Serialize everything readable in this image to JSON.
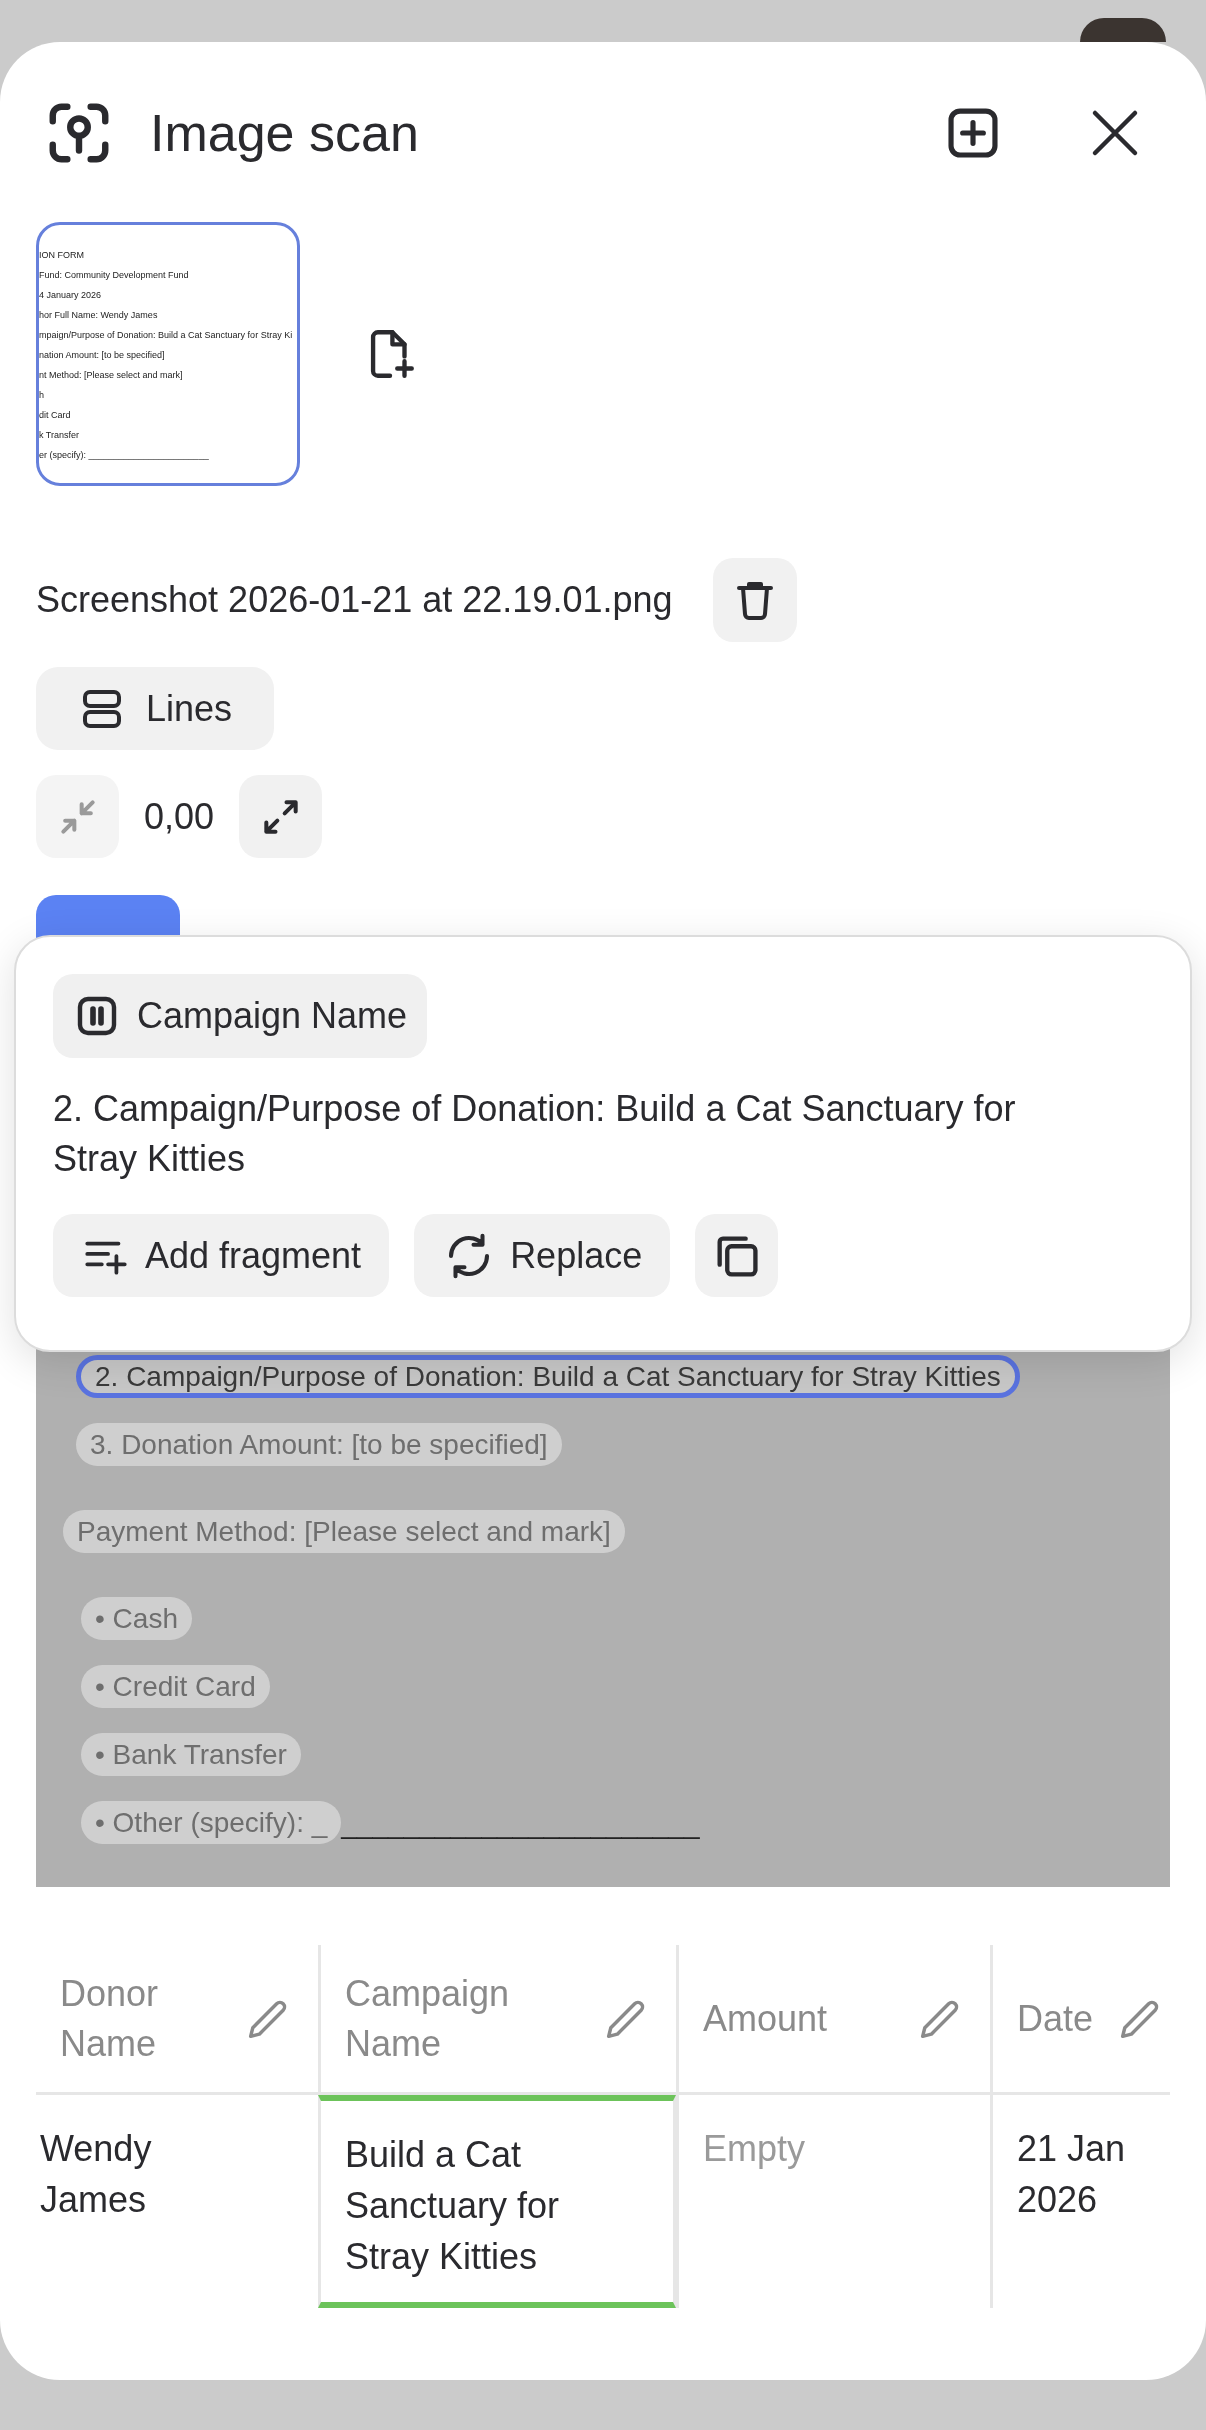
{
  "header": {
    "title": "Image scan"
  },
  "thumbnail": {
    "selected": true,
    "lines": [
      "ION FORM",
      "Fund: Community Development Fund",
      "4 January 2026",
      "hor Full Name: Wendy James",
      "mpaign/Purpose of Donation: Build a Cat Sanctuary for Stray Ki",
      "nation Amount: [to be specified]",
      "nt Method: [Please select and mark]",
      "h",
      "dit Card",
      "k Transfer",
      "er (specify): ________________________"
    ]
  },
  "file": {
    "name": "Screenshot 2026-01-21 at 22.19.01.png"
  },
  "mode_button": {
    "label": "Lines"
  },
  "zoom": {
    "value": "0,00",
    "shrink_disabled": true,
    "expand_disabled": false
  },
  "actions": [
    {
      "kind": "primary"
    }
  ],
  "popup": {
    "field_chip": "Campaign Name",
    "text": "2. Campaign/Purpose of Donation: Build a Cat Sanctuary for Stray Kitties",
    "buttons": [
      {
        "label": "Add fragment",
        "kind": "add"
      },
      {
        "label": "Replace",
        "kind": "replace"
      },
      {
        "kind": "copy"
      }
    ]
  },
  "scan_lines": [
    {
      "kind": "numbered",
      "text": "2.  Campaign/Purpose of Donation: Build a Cat Sanctuary for Stray Kitties",
      "selected": true
    },
    {
      "kind": "numbered",
      "text": "3.  Donation Amount: [to be specified]",
      "selected": false
    },
    {
      "kind": "plain",
      "text": "Payment Method: [Please select and mark]",
      "selected": false
    },
    {
      "kind": "bullet",
      "text": "•  Cash",
      "selected": false
    },
    {
      "kind": "bullet",
      "text": "•  Credit Card",
      "selected": false
    },
    {
      "kind": "bullet",
      "text": "•  Bank Transfer",
      "selected": false
    },
    {
      "kind": "bullet",
      "text": "•  Other (specify): _",
      "trailing": "_______________________",
      "selected": false
    }
  ],
  "table": {
    "columns": [
      "Donor Name",
      "Campaign Name",
      "Amount",
      "Date"
    ],
    "rows": [
      {
        "cells": [
          {
            "text": "Wendy James",
            "selected": false
          },
          {
            "text": "Build a Cat Sanctuary for Stray Kitties",
            "selected": true
          },
          {
            "placeholder": "Empty",
            "selected": false
          },
          {
            "text": "21 Jan 2026",
            "selected": false
          }
        ]
      }
    ]
  }
}
